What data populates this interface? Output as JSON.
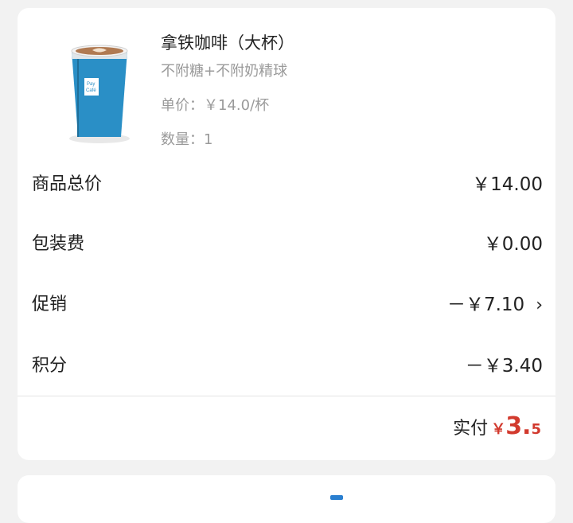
{
  "product": {
    "title": "拿铁咖啡（大杯）",
    "spec": "不附糖+不附奶精球",
    "unit_price": "单价：￥14.0/杯",
    "quantity": "数量：1",
    "image_icon": "coffee-cup-icon",
    "cup_text_1": "Pay",
    "cup_text_2": "Café"
  },
  "summary": {
    "rows": [
      {
        "label": "商品总价",
        "value": "￥14.00"
      },
      {
        "label": "包装费",
        "value": "￥0.00"
      },
      {
        "label": "促销",
        "value": "－￥7.10"
      },
      {
        "label": "积分",
        "value": "－￥3.40"
      }
    ]
  },
  "total": {
    "label": "实付",
    "currency": "￥",
    "amount_int": "3.",
    "amount_dec": "5"
  },
  "colors": {
    "accent_red": "#d23a2e",
    "cup_blue": "#2a8fc6"
  }
}
